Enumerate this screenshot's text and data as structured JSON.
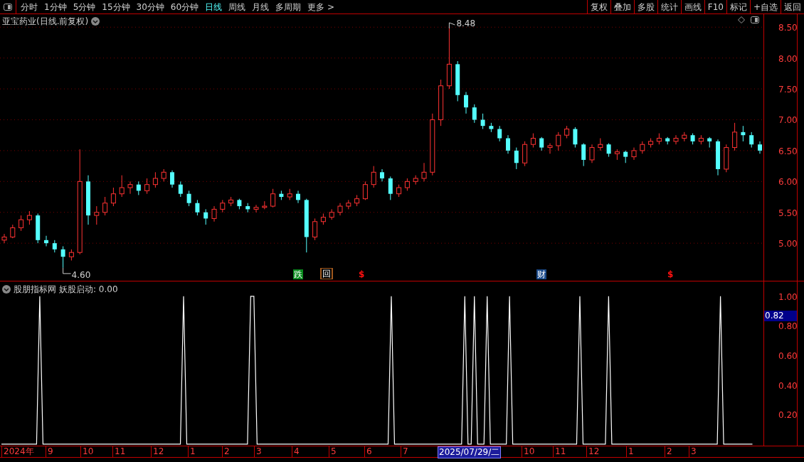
{
  "toolbar": {
    "periods": [
      {
        "label": "分时",
        "selected": false
      },
      {
        "label": "1分钟",
        "selected": false
      },
      {
        "label": "5分钟",
        "selected": false
      },
      {
        "label": "15分钟",
        "selected": false
      },
      {
        "label": "30分钟",
        "selected": false
      },
      {
        "label": "60分钟",
        "selected": false
      },
      {
        "label": "日线",
        "selected": true
      },
      {
        "label": "周线",
        "selected": false
      },
      {
        "label": "月线",
        "selected": false
      },
      {
        "label": "多周期",
        "selected": false
      },
      {
        "label": "更多 >",
        "selected": false
      }
    ],
    "buttons": [
      "复权",
      "叠加",
      "多股",
      "统计",
      "画线",
      "F10",
      "标记",
      "+自选",
      "返回"
    ]
  },
  "main_chart": {
    "title": "亚宝药业(日线.前复权)",
    "high_label": "8.48",
    "low_label": "4.60",
    "chart_data": {
      "type": "candlestick",
      "ylim": [
        4.38,
        8.71
      ],
      "grid": true,
      "yticks": [
        {
          "value": 8.5,
          "label": "8.50"
        },
        {
          "value": 8,
          "label": "8.00"
        },
        {
          "value": 7.5,
          "label": "7.50"
        },
        {
          "value": 7,
          "label": "7.00"
        },
        {
          "value": 6.5,
          "label": "6.50"
        },
        {
          "value": 6,
          "label": "6.00"
        },
        {
          "value": 5.5,
          "label": "5.50"
        },
        {
          "value": 5,
          "label": "5.00"
        }
      ],
      "ohlc": [
        [
          5.05,
          5.15,
          5.0,
          5.1
        ],
        [
          5.1,
          5.3,
          5.08,
          5.25
        ],
        [
          5.25,
          5.45,
          5.2,
          5.38
        ],
        [
          5.38,
          5.52,
          5.3,
          5.45
        ],
        [
          5.45,
          5.48,
          5.0,
          5.05
        ],
        [
          5.05,
          5.12,
          4.95,
          5.0
        ],
        [
          5.0,
          5.05,
          4.85,
          4.9
        ],
        [
          4.9,
          4.95,
          4.6,
          4.78
        ],
        [
          4.78,
          4.9,
          4.72,
          4.85
        ],
        [
          4.85,
          6.52,
          4.82,
          6.0
        ],
        [
          6.0,
          6.1,
          5.3,
          5.45
        ],
        [
          5.45,
          5.6,
          5.3,
          5.5
        ],
        [
          5.5,
          5.75,
          5.45,
          5.65
        ],
        [
          5.65,
          5.9,
          5.6,
          5.8
        ],
        [
          5.8,
          6.1,
          5.75,
          5.9
        ],
        [
          5.9,
          6.0,
          5.8,
          5.95
        ],
        [
          5.95,
          6.0,
          5.78,
          5.85
        ],
        [
          5.85,
          6.05,
          5.8,
          5.95
        ],
        [
          5.95,
          6.15,
          5.9,
          6.05
        ],
        [
          6.05,
          6.2,
          6.0,
          6.15
        ],
        [
          6.15,
          6.18,
          5.9,
          5.95
        ],
        [
          5.95,
          6.0,
          5.75,
          5.8
        ],
        [
          5.8,
          5.85,
          5.6,
          5.65
        ],
        [
          5.65,
          5.7,
          5.45,
          5.5
        ],
        [
          5.5,
          5.55,
          5.3,
          5.4
        ],
        [
          5.4,
          5.6,
          5.35,
          5.55
        ],
        [
          5.55,
          5.7,
          5.5,
          5.65
        ],
        [
          5.65,
          5.75,
          5.6,
          5.7
        ],
        [
          5.7,
          5.72,
          5.55,
          5.6
        ],
        [
          5.6,
          5.65,
          5.5,
          5.55
        ],
        [
          5.55,
          5.62,
          5.5,
          5.58
        ],
        [
          5.58,
          5.68,
          5.55,
          5.6
        ],
        [
          5.6,
          5.88,
          5.58,
          5.8
        ],
        [
          5.8,
          5.85,
          5.7,
          5.75
        ],
        [
          5.75,
          5.88,
          5.7,
          5.8
        ],
        [
          5.8,
          5.85,
          5.65,
          5.7
        ],
        [
          5.7,
          5.72,
          4.85,
          5.1
        ],
        [
          5.1,
          5.4,
          5.05,
          5.35
        ],
        [
          5.35,
          5.48,
          5.3,
          5.42
        ],
        [
          5.42,
          5.55,
          5.38,
          5.5
        ],
        [
          5.5,
          5.65,
          5.45,
          5.6
        ],
        [
          5.6,
          5.7,
          5.55,
          5.65
        ],
        [
          5.65,
          5.78,
          5.6,
          5.72
        ],
        [
          5.72,
          6.0,
          5.7,
          5.95
        ],
        [
          5.95,
          6.25,
          5.9,
          6.15
        ],
        [
          6.15,
          6.2,
          6.0,
          6.05
        ],
        [
          6.05,
          6.08,
          5.7,
          5.8
        ],
        [
          5.8,
          5.95,
          5.75,
          5.9
        ],
        [
          5.9,
          6.05,
          5.85,
          6.0
        ],
        [
          6.0,
          6.1,
          5.95,
          6.05
        ],
        [
          6.05,
          6.3,
          6.0,
          6.15
        ],
        [
          6.15,
          7.1,
          6.1,
          7.0
        ],
        [
          7.0,
          7.65,
          6.9,
          7.55
        ],
        [
          7.55,
          8.48,
          7.5,
          7.9
        ],
        [
          7.9,
          7.95,
          7.3,
          7.4
        ],
        [
          7.4,
          7.45,
          7.1,
          7.2
        ],
        [
          7.2,
          7.25,
          6.95,
          7.0
        ],
        [
          7.0,
          7.1,
          6.85,
          6.9
        ],
        [
          6.9,
          6.95,
          6.8,
          6.85
        ],
        [
          6.85,
          6.9,
          6.65,
          6.7
        ],
        [
          6.7,
          6.75,
          6.45,
          6.5
        ],
        [
          6.5,
          6.55,
          6.2,
          6.3
        ],
        [
          6.3,
          6.65,
          6.25,
          6.6
        ],
        [
          6.6,
          6.78,
          6.55,
          6.7
        ],
        [
          6.7,
          6.72,
          6.5,
          6.55
        ],
        [
          6.55,
          6.62,
          6.45,
          6.58
        ],
        [
          6.58,
          6.8,
          6.5,
          6.75
        ],
        [
          6.75,
          6.9,
          6.7,
          6.85
        ],
        [
          6.85,
          6.88,
          6.55,
          6.6
        ],
        [
          6.6,
          6.62,
          6.25,
          6.35
        ],
        [
          6.35,
          6.6,
          6.3,
          6.55
        ],
        [
          6.55,
          6.7,
          6.5,
          6.6
        ],
        [
          6.6,
          6.62,
          6.4,
          6.45
        ],
        [
          6.45,
          6.52,
          6.35,
          6.48
        ],
        [
          6.48,
          6.5,
          6.3,
          6.4
        ],
        [
          6.4,
          6.55,
          6.35,
          6.5
        ],
        [
          6.5,
          6.65,
          6.45,
          6.6
        ],
        [
          6.6,
          6.7,
          6.55,
          6.65
        ],
        [
          6.65,
          6.78,
          6.6,
          6.7
        ],
        [
          6.7,
          6.72,
          6.6,
          6.65
        ],
        [
          6.65,
          6.75,
          6.6,
          6.7
        ],
        [
          6.7,
          6.8,
          6.65,
          6.75
        ],
        [
          6.75,
          6.78,
          6.6,
          6.65
        ],
        [
          6.65,
          6.75,
          6.6,
          6.7
        ],
        [
          6.7,
          6.72,
          6.55,
          6.65
        ],
        [
          6.65,
          6.68,
          6.1,
          6.2
        ],
        [
          6.2,
          6.6,
          6.15,
          6.55
        ],
        [
          6.55,
          6.95,
          6.5,
          6.8
        ],
        [
          6.8,
          6.9,
          6.65,
          6.75
        ],
        [
          6.75,
          6.8,
          6.55,
          6.6
        ],
        [
          6.6,
          6.65,
          6.45,
          6.5
        ]
      ]
    },
    "markers": [
      {
        "text": "跌",
        "kind": "filled",
        "color": "#0a8a1e"
      },
      {
        "text": "回",
        "kind": "framed",
        "color": "#a0581e"
      },
      {
        "text": "$",
        "kind": "plain",
        "color": "#ff1010"
      },
      {
        "text": "财",
        "kind": "filled",
        "color": "#1a4a8a"
      },
      {
        "text": "$",
        "kind": "plain",
        "color": "#ff1010"
      }
    ]
  },
  "indicator": {
    "source": "股朋指标网",
    "reading": "妖股启动: 0.00",
    "current_value": "0.82",
    "chart_data": {
      "type": "line",
      "ylim": [
        -0.01,
        1.1
      ],
      "yticks": [
        {
          "value": 1,
          "label": "1.00"
        },
        {
          "value": 0.8,
          "label": "0.80"
        },
        {
          "value": 0.6,
          "label": "0.60"
        },
        {
          "value": 0.4,
          "label": "0.40"
        },
        {
          "value": 0.2,
          "label": "0.20"
        }
      ],
      "categories": [
        null,
        null,
        null,
        null,
        null,
        null,
        null,
        null,
        null,
        null,
        null,
        null,
        null,
        null,
        null,
        null,
        null,
        null,
        null,
        null,
        null,
        null,
        null,
        null,
        null,
        null,
        null,
        null,
        null,
        null,
        null,
        null,
        null,
        null,
        null,
        null,
        null,
        null,
        null,
        null,
        null,
        null,
        null,
        null,
        null,
        null,
        null,
        null,
        null,
        null,
        null,
        null,
        null,
        null,
        null,
        null,
        null,
        null,
        null,
        null,
        null,
        null,
        null,
        null,
        null,
        null,
        null,
        null,
        null,
        null,
        null,
        null,
        null,
        null,
        null,
        null,
        null,
        null,
        null,
        null,
        null,
        null,
        null,
        null,
        null,
        null,
        null,
        null,
        null,
        null,
        null,
        null,
        null,
        null,
        null,
        null,
        null,
        null,
        null,
        null,
        null,
        null,
        null,
        null,
        null,
        null,
        null,
        null,
        null,
        null,
        null,
        null,
        null,
        null,
        null,
        null,
        null,
        null,
        null,
        null,
        null,
        null,
        null,
        null,
        null,
        null,
        null,
        null,
        null,
        null,
        null,
        null,
        null,
        null,
        null,
        null,
        null,
        null,
        null,
        null,
        null,
        null,
        null,
        null,
        null,
        null,
        null,
        null,
        null,
        null,
        null,
        null,
        null,
        null,
        null,
        null,
        null,
        null,
        null,
        null,
        null,
        null,
        null,
        null,
        null,
        null,
        null,
        null,
        null,
        null,
        null,
        null,
        null,
        null,
        null,
        null,
        null,
        null,
        null,
        null,
        null,
        null,
        null,
        null,
        null,
        null,
        null,
        null,
        null,
        null,
        null,
        null,
        null,
        null,
        null,
        null,
        null,
        null,
        null,
        null,
        null,
        null,
        null,
        null,
        null,
        null,
        null,
        null,
        null,
        null,
        null,
        null,
        null,
        null,
        null,
        null,
        null,
        null,
        null,
        null,
        null,
        null,
        null,
        null,
        null,
        null,
        null,
        null,
        null,
        null,
        null,
        null,
        null,
        null,
        null,
        null
      ],
      "series": [
        {
          "color": "#ffffff",
          "values": [
            0,
            0,
            0,
            0,
            0,
            0,
            0,
            0,
            0,
            0,
            0,
            0,
            1,
            0,
            0,
            0,
            0,
            0,
            0,
            0,
            0,
            0,
            0,
            0,
            0,
            0,
            0,
            0,
            0,
            0,
            0,
            0,
            0,
            0,
            0,
            0,
            0,
            0,
            0,
            0,
            0,
            0,
            0,
            0,
            0,
            0,
            0,
            0,
            0,
            0,
            0,
            0,
            0,
            0,
            0,
            0,
            0,
            1,
            0,
            0,
            0,
            0,
            0,
            0,
            0,
            0,
            0,
            0,
            0,
            0,
            0,
            0,
            0,
            0,
            0,
            0,
            0,
            0,
            1,
            1,
            0,
            0,
            0,
            0,
            0,
            0,
            0,
            0,
            0,
            0,
            0,
            0,
            0,
            0,
            0,
            0,
            0,
            0,
            0,
            0,
            0,
            0,
            0,
            0,
            0,
            0,
            0,
            0,
            0,
            0,
            0,
            0,
            0,
            0,
            0,
            0,
            0,
            0,
            0,
            0,
            0,
            0,
            1,
            0,
            0,
            0,
            0,
            0,
            0,
            0,
            0,
            0,
            0,
            0,
            0,
            0,
            0,
            0,
            0,
            0,
            0,
            0,
            0,
            0,
            0,
            1,
            0,
            0,
            1,
            0,
            0,
            0,
            1,
            0,
            0,
            0,
            0,
            0,
            0,
            1,
            0,
            0,
            0,
            0,
            0,
            0,
            0,
            0,
            0,
            0,
            0,
            0,
            0,
            0,
            0,
            0,
            0,
            0,
            0,
            0,
            0,
            1,
            0,
            0,
            0,
            0,
            0,
            0,
            0,
            0,
            1,
            0,
            0,
            0,
            0,
            0,
            0,
            0,
            0,
            0,
            0,
            0,
            0,
            0,
            0,
            0,
            0,
            0,
            0,
            0,
            0,
            0,
            0,
            0,
            0,
            0,
            0,
            0,
            0,
            0,
            0,
            0,
            0,
            0,
            0,
            1,
            0,
            0,
            0,
            0,
            0,
            0,
            0,
            0,
            0,
            0
          ]
        }
      ]
    }
  },
  "time_axis": [
    {
      "label": "2024年",
      "kind": "tick"
    },
    {
      "label": "9",
      "kind": "tick"
    },
    {
      "label": "10",
      "kind": "tick"
    },
    {
      "label": "11",
      "kind": "tick"
    },
    {
      "label": "12",
      "kind": "tick"
    },
    {
      "label": "1",
      "kind": "tick"
    },
    {
      "label": "2",
      "kind": "tick"
    },
    {
      "label": "3",
      "kind": "tick"
    },
    {
      "label": "4",
      "kind": "tick"
    },
    {
      "label": "5",
      "kind": "tick"
    },
    {
      "label": "6",
      "kind": "tick"
    },
    {
      "label": "7",
      "kind": "tick"
    },
    {
      "label": "2025/07/29/二",
      "kind": "cursor"
    },
    {
      "label": "10",
      "kind": "tick"
    },
    {
      "label": "11",
      "kind": "tick"
    },
    {
      "label": "12",
      "kind": "tick"
    },
    {
      "label": "1",
      "kind": "tick"
    },
    {
      "label": "2",
      "kind": "tick"
    },
    {
      "label": "3",
      "kind": "tick"
    }
  ]
}
